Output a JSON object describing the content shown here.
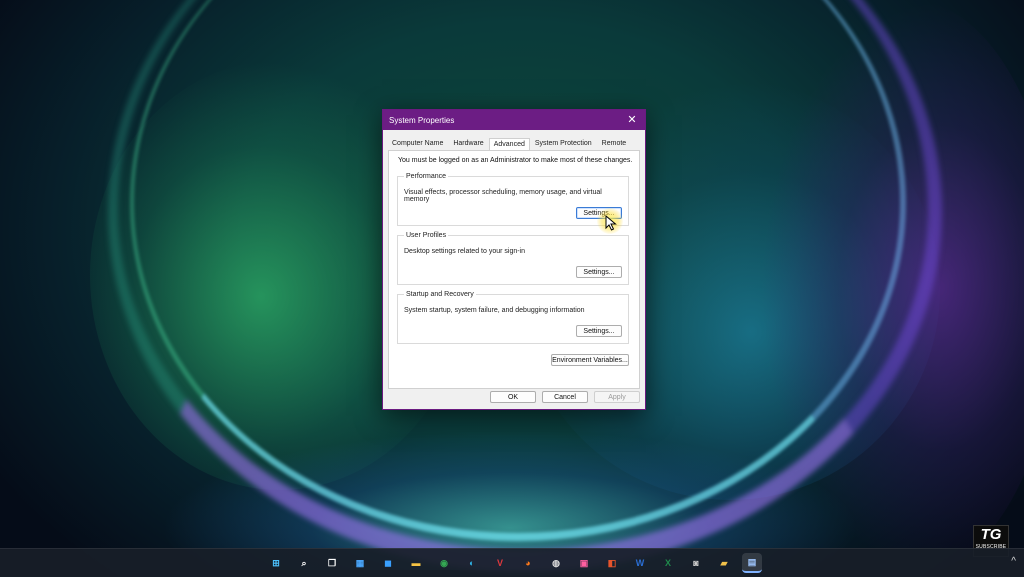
{
  "dialog": {
    "title": "System Properties",
    "close_glyph": "✕",
    "tabs": [
      {
        "label": "Computer Name",
        "active": false
      },
      {
        "label": "Hardware",
        "active": false
      },
      {
        "label": "Advanced",
        "active": true
      },
      {
        "label": "System Protection",
        "active": false
      },
      {
        "label": "Remote",
        "active": false
      }
    ],
    "admin_note": "You must be logged on as an Administrator to make most of these changes.",
    "performance": {
      "title": "Performance",
      "description": "Visual effects, processor scheduling, memory usage, and virtual memory",
      "button": "Settings..."
    },
    "user_profiles": {
      "title": "User Profiles",
      "description": "Desktop settings related to your sign-in",
      "button": "Settings..."
    },
    "startup_recovery": {
      "title": "Startup and Recovery",
      "description": "System startup, system failure, and debugging information",
      "button": "Settings..."
    },
    "env_button": "Environment Variables...",
    "ok_button": "OK",
    "cancel_button": "Cancel",
    "apply_button": "Apply"
  },
  "taskbar": {
    "icons": [
      {
        "name": "start-icon",
        "glyph": "⊞",
        "color": "#4cc2ff"
      },
      {
        "name": "search-icon",
        "glyph": "⌕",
        "color": "#ffffff"
      },
      {
        "name": "task-view-icon",
        "glyph": "❐",
        "color": "#ffffff"
      },
      {
        "name": "widgets-icon",
        "glyph": "▦",
        "color": "#4aa8ff"
      },
      {
        "name": "store-icon",
        "glyph": "◼",
        "color": "#3aa0ff"
      },
      {
        "name": "file-explorer-icon",
        "glyph": "▬",
        "color": "#f6c343"
      },
      {
        "name": "chrome-icon",
        "glyph": "◉",
        "color": "#34a853"
      },
      {
        "name": "edge-icon",
        "glyph": "◐",
        "color": "#2fb5e8"
      },
      {
        "name": "vivaldi-icon",
        "glyph": "V",
        "color": "#e0393e"
      },
      {
        "name": "firefox-icon",
        "glyph": "◕",
        "color": "#ff7a1a"
      },
      {
        "name": "obs-icon",
        "glyph": "◍",
        "color": "#dddddd"
      },
      {
        "name": "photos-icon",
        "glyph": "▣",
        "color": "#ff5fa0"
      },
      {
        "name": "office-icon",
        "glyph": "◧",
        "color": "#e8542b"
      },
      {
        "name": "word-icon",
        "glyph": "W",
        "color": "#2b6fd6"
      },
      {
        "name": "excel-icon",
        "glyph": "X",
        "color": "#1f8a4c"
      },
      {
        "name": "camera-icon",
        "glyph": "◙",
        "color": "#cccccc"
      },
      {
        "name": "folder-icon",
        "glyph": "▰",
        "color": "#f2c24b"
      },
      {
        "name": "system-properties-icon",
        "glyph": "▤",
        "color": "#9fc6ff"
      }
    ],
    "tray_chevron": "^"
  },
  "watermark": {
    "logo_text": "TG",
    "sub_text": "SUBSCRIBE"
  }
}
